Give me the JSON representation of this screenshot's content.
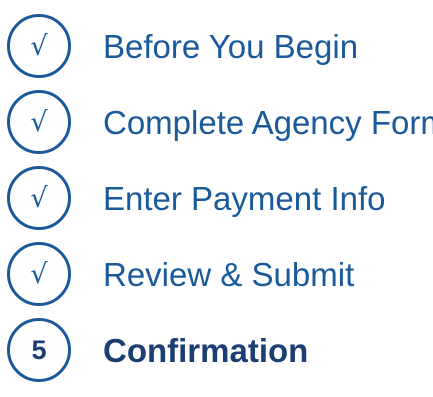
{
  "steps": [
    {
      "icon": "check-icon",
      "marker": "√",
      "label": "Before You Begin",
      "status": "complete"
    },
    {
      "icon": "check-icon",
      "marker": "√",
      "label": "Complete Agency Form",
      "status": "complete"
    },
    {
      "icon": "check-icon",
      "marker": "√",
      "label": "Enter Payment Info",
      "status": "complete"
    },
    {
      "icon": "check-icon",
      "marker": "√",
      "label": "Review & Submit",
      "status": "complete"
    },
    {
      "icon": "step-number",
      "marker": "5",
      "label": "Confirmation",
      "status": "current"
    }
  ],
  "colors": {
    "accent": "#1a5a9b",
    "current": "#1b3f73",
    "background": "#ffffff"
  }
}
